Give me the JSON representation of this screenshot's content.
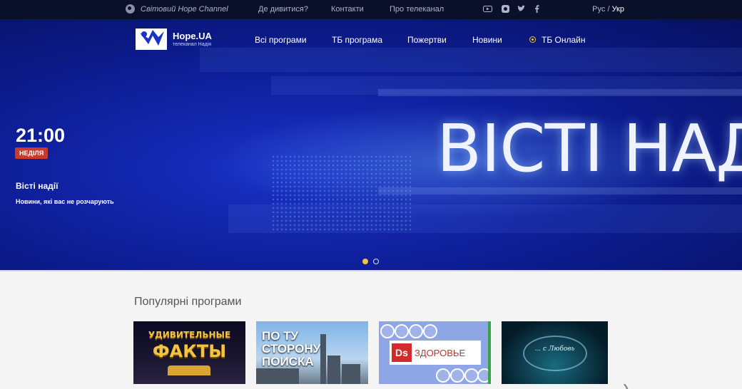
{
  "topbar": {
    "world_label": "Світовий Hope Channel",
    "links": [
      "Де дивитися?",
      "Контакти",
      "Про телеканал"
    ],
    "social": [
      "youtube-icon",
      "instagram-icon",
      "twitter-icon",
      "facebook-icon"
    ],
    "lang_other": "Рус",
    "lang_sep": "/",
    "lang_active": "Укр"
  },
  "logo": {
    "name": "Hope.UA",
    "subtitle": "телеканал Надія"
  },
  "nav": {
    "all_programs": "Всі програми",
    "tv_program": "ТБ програма",
    "donations": "Пожертви",
    "news": "Новини",
    "tv_online": "ТБ Онлайн"
  },
  "hero": {
    "time": "21:00",
    "day": "НЕДІЛЯ",
    "title": "Вісті надії",
    "description": "Новини, які вас не розчарують",
    "banner_text": "ВІСТІ НАД"
  },
  "popular": {
    "title": "Популярні програми",
    "items": [
      {
        "line1": "УДИВИТЕЛЬНЫЕ",
        "line2": "ФАКТЫ"
      },
      {
        "line1": "ПО ТУ",
        "line2": "СТОРОНУ",
        "line3": "ПОИСКА"
      },
      {
        "logo": "Ds",
        "name": "ЗДОРОВЬЕ"
      },
      {
        "script": "... с Любовь"
      }
    ]
  },
  "colors": {
    "accent": "#f2c440",
    "hero_blue": "#0e1f9a",
    "badge_red": "#c83a2a"
  }
}
